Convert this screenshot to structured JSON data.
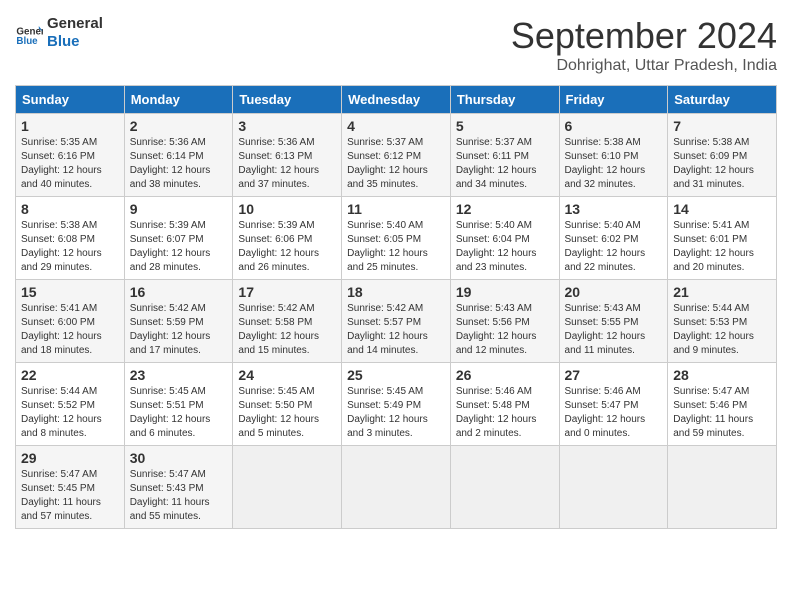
{
  "header": {
    "logo_line1": "General",
    "logo_line2": "Blue",
    "month": "September 2024",
    "location": "Dohrighat, Uttar Pradesh, India"
  },
  "weekdays": [
    "Sunday",
    "Monday",
    "Tuesday",
    "Wednesday",
    "Thursday",
    "Friday",
    "Saturday"
  ],
  "weeks": [
    [
      {
        "day": "1",
        "sunrise": "Sunrise: 5:35 AM",
        "sunset": "Sunset: 6:16 PM",
        "daylight": "Daylight: 12 hours and 40 minutes."
      },
      {
        "day": "2",
        "sunrise": "Sunrise: 5:36 AM",
        "sunset": "Sunset: 6:14 PM",
        "daylight": "Daylight: 12 hours and 38 minutes."
      },
      {
        "day": "3",
        "sunrise": "Sunrise: 5:36 AM",
        "sunset": "Sunset: 6:13 PM",
        "daylight": "Daylight: 12 hours and 37 minutes."
      },
      {
        "day": "4",
        "sunrise": "Sunrise: 5:37 AM",
        "sunset": "Sunset: 6:12 PM",
        "daylight": "Daylight: 12 hours and 35 minutes."
      },
      {
        "day": "5",
        "sunrise": "Sunrise: 5:37 AM",
        "sunset": "Sunset: 6:11 PM",
        "daylight": "Daylight: 12 hours and 34 minutes."
      },
      {
        "day": "6",
        "sunrise": "Sunrise: 5:38 AM",
        "sunset": "Sunset: 6:10 PM",
        "daylight": "Daylight: 12 hours and 32 minutes."
      },
      {
        "day": "7",
        "sunrise": "Sunrise: 5:38 AM",
        "sunset": "Sunset: 6:09 PM",
        "daylight": "Daylight: 12 hours and 31 minutes."
      }
    ],
    [
      {
        "day": "8",
        "sunrise": "Sunrise: 5:38 AM",
        "sunset": "Sunset: 6:08 PM",
        "daylight": "Daylight: 12 hours and 29 minutes."
      },
      {
        "day": "9",
        "sunrise": "Sunrise: 5:39 AM",
        "sunset": "Sunset: 6:07 PM",
        "daylight": "Daylight: 12 hours and 28 minutes."
      },
      {
        "day": "10",
        "sunrise": "Sunrise: 5:39 AM",
        "sunset": "Sunset: 6:06 PM",
        "daylight": "Daylight: 12 hours and 26 minutes."
      },
      {
        "day": "11",
        "sunrise": "Sunrise: 5:40 AM",
        "sunset": "Sunset: 6:05 PM",
        "daylight": "Daylight: 12 hours and 25 minutes."
      },
      {
        "day": "12",
        "sunrise": "Sunrise: 5:40 AM",
        "sunset": "Sunset: 6:04 PM",
        "daylight": "Daylight: 12 hours and 23 minutes."
      },
      {
        "day": "13",
        "sunrise": "Sunrise: 5:40 AM",
        "sunset": "Sunset: 6:02 PM",
        "daylight": "Daylight: 12 hours and 22 minutes."
      },
      {
        "day": "14",
        "sunrise": "Sunrise: 5:41 AM",
        "sunset": "Sunset: 6:01 PM",
        "daylight": "Daylight: 12 hours and 20 minutes."
      }
    ],
    [
      {
        "day": "15",
        "sunrise": "Sunrise: 5:41 AM",
        "sunset": "Sunset: 6:00 PM",
        "daylight": "Daylight: 12 hours and 18 minutes."
      },
      {
        "day": "16",
        "sunrise": "Sunrise: 5:42 AM",
        "sunset": "Sunset: 5:59 PM",
        "daylight": "Daylight: 12 hours and 17 minutes."
      },
      {
        "day": "17",
        "sunrise": "Sunrise: 5:42 AM",
        "sunset": "Sunset: 5:58 PM",
        "daylight": "Daylight: 12 hours and 15 minutes."
      },
      {
        "day": "18",
        "sunrise": "Sunrise: 5:42 AM",
        "sunset": "Sunset: 5:57 PM",
        "daylight": "Daylight: 12 hours and 14 minutes."
      },
      {
        "day": "19",
        "sunrise": "Sunrise: 5:43 AM",
        "sunset": "Sunset: 5:56 PM",
        "daylight": "Daylight: 12 hours and 12 minutes."
      },
      {
        "day": "20",
        "sunrise": "Sunrise: 5:43 AM",
        "sunset": "Sunset: 5:55 PM",
        "daylight": "Daylight: 12 hours and 11 minutes."
      },
      {
        "day": "21",
        "sunrise": "Sunrise: 5:44 AM",
        "sunset": "Sunset: 5:53 PM",
        "daylight": "Daylight: 12 hours and 9 minutes."
      }
    ],
    [
      {
        "day": "22",
        "sunrise": "Sunrise: 5:44 AM",
        "sunset": "Sunset: 5:52 PM",
        "daylight": "Daylight: 12 hours and 8 minutes."
      },
      {
        "day": "23",
        "sunrise": "Sunrise: 5:45 AM",
        "sunset": "Sunset: 5:51 PM",
        "daylight": "Daylight: 12 hours and 6 minutes."
      },
      {
        "day": "24",
        "sunrise": "Sunrise: 5:45 AM",
        "sunset": "Sunset: 5:50 PM",
        "daylight": "Daylight: 12 hours and 5 minutes."
      },
      {
        "day": "25",
        "sunrise": "Sunrise: 5:45 AM",
        "sunset": "Sunset: 5:49 PM",
        "daylight": "Daylight: 12 hours and 3 minutes."
      },
      {
        "day": "26",
        "sunrise": "Sunrise: 5:46 AM",
        "sunset": "Sunset: 5:48 PM",
        "daylight": "Daylight: 12 hours and 2 minutes."
      },
      {
        "day": "27",
        "sunrise": "Sunrise: 5:46 AM",
        "sunset": "Sunset: 5:47 PM",
        "daylight": "Daylight: 12 hours and 0 minutes."
      },
      {
        "day": "28",
        "sunrise": "Sunrise: 5:47 AM",
        "sunset": "Sunset: 5:46 PM",
        "daylight": "Daylight: 11 hours and 59 minutes."
      }
    ],
    [
      {
        "day": "29",
        "sunrise": "Sunrise: 5:47 AM",
        "sunset": "Sunset: 5:45 PM",
        "daylight": "Daylight: 11 hours and 57 minutes."
      },
      {
        "day": "30",
        "sunrise": "Sunrise: 5:47 AM",
        "sunset": "Sunset: 5:43 PM",
        "daylight": "Daylight: 11 hours and 55 minutes."
      },
      null,
      null,
      null,
      null,
      null
    ]
  ]
}
